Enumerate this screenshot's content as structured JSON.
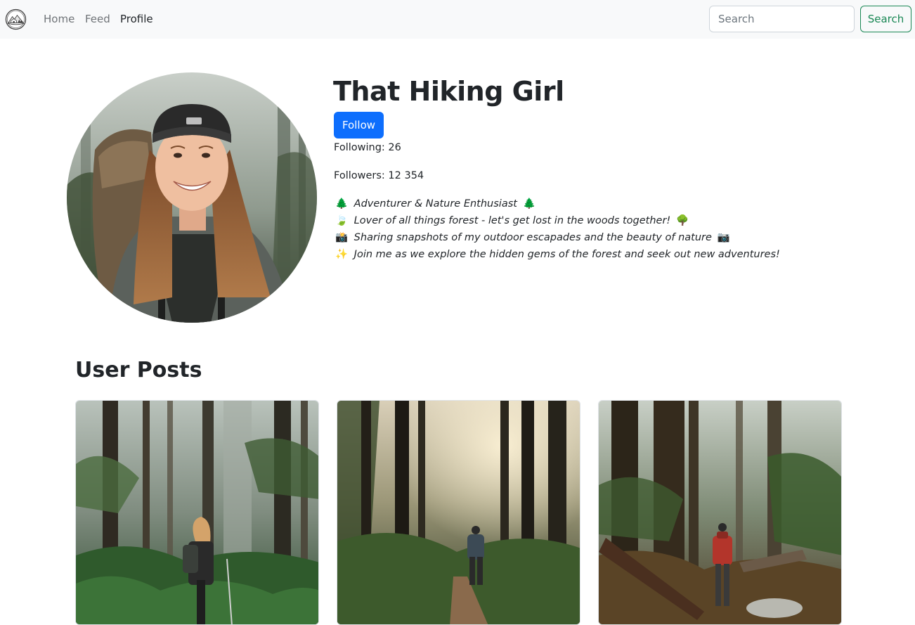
{
  "nav": {
    "logo_icon": "mountain-logo-icon",
    "links": [
      {
        "label": "Home",
        "active": false
      },
      {
        "label": "Feed",
        "active": false
      },
      {
        "label": "Profile",
        "active": true
      }
    ],
    "search_placeholder": "Search",
    "search_button": "Search"
  },
  "profile": {
    "name": "That Hiking Girl",
    "follow_label": "Follow",
    "following": "Following: 26",
    "followers": "Followers: 12 354",
    "bio": [
      {
        "lead": "🌲",
        "text": "Adventurer & Nature Enthusiast",
        "trail": "🌲"
      },
      {
        "lead": "🍃",
        "text": "Lover of all things forest - let's get lost in the woods together!",
        "trail": "🌳"
      },
      {
        "lead": "📸",
        "text": "Sharing snapshots of my outdoor escapades and the beauty of nature",
        "trail": "📷"
      },
      {
        "lead": "✨",
        "text": "Join me as we explore the hidden gems of the forest and seek out new adventures!",
        "trail": ""
      }
    ]
  },
  "posts": {
    "title": "User Posts"
  },
  "colors": {
    "navbar_bg": "#f8f9fa",
    "primary": "#0d6efd",
    "success": "#198754",
    "text": "#212529",
    "muted_link": "#707478"
  }
}
